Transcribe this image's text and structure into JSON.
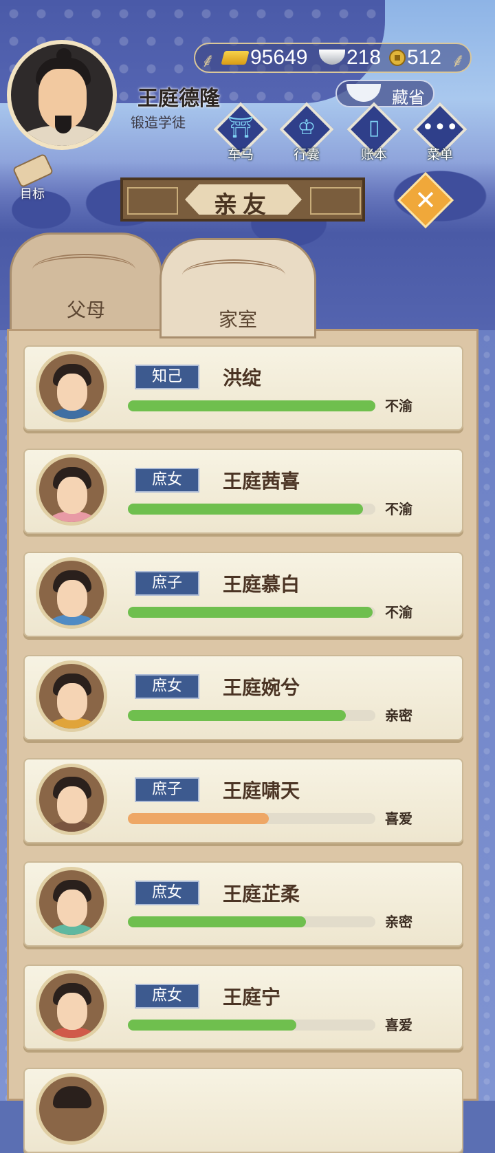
{
  "player": {
    "name": "王庭德隆",
    "rank": "锻造学徒"
  },
  "currency": {
    "gold": "95649",
    "silver": "218",
    "coin": "512"
  },
  "hide_button": {
    "label": "藏省",
    "icon": "hat-icon"
  },
  "menu": [
    {
      "label": "车马",
      "icon": "carriage-icon"
    },
    {
      "label": "行囊",
      "icon": "bag-icon"
    },
    {
      "label": "账本",
      "icon": "ledger-icon"
    },
    {
      "label": "菜单",
      "icon": "more-icon"
    }
  ],
  "goal_button": {
    "label": "目标"
  },
  "title": "亲友",
  "tabs": [
    {
      "label": "父母",
      "active": false
    },
    {
      "label": "家室",
      "active": true
    }
  ],
  "colors": {
    "bar_green": "#6fbf4e",
    "bar_orange": "#eea765",
    "tag_blue": "#3d5a8f"
  },
  "relatives": [
    {
      "tag": "知己",
      "name": "洪绽",
      "status": "不渝",
      "progress": 1.0,
      "bar_color": "green",
      "body": "#3f6fa3"
    },
    {
      "tag": "庶女",
      "name": "王庭茜喜",
      "status": "不渝",
      "progress": 0.95,
      "bar_color": "green",
      "body": "#e89aa5"
    },
    {
      "tag": "庶子",
      "name": "王庭慕白",
      "status": "不渝",
      "progress": 0.99,
      "bar_color": "green",
      "body": "#4f8bc4"
    },
    {
      "tag": "庶女",
      "name": "王庭婉兮",
      "status": "亲密",
      "progress": 0.88,
      "bar_color": "green",
      "body": "#e0a43a"
    },
    {
      "tag": "庶子",
      "name": "王庭啸天",
      "status": "喜爱",
      "progress": 0.57,
      "bar_color": "orange",
      "body": "#7a5540"
    },
    {
      "tag": "庶女",
      "name": "王庭芷柔",
      "status": "亲密",
      "progress": 0.72,
      "bar_color": "green",
      "body": "#5fb8a0"
    },
    {
      "tag": "庶女",
      "name": "王庭宁",
      "status": "喜爱",
      "progress": 0.68,
      "bar_color": "green",
      "body": "#d05a4a"
    }
  ]
}
